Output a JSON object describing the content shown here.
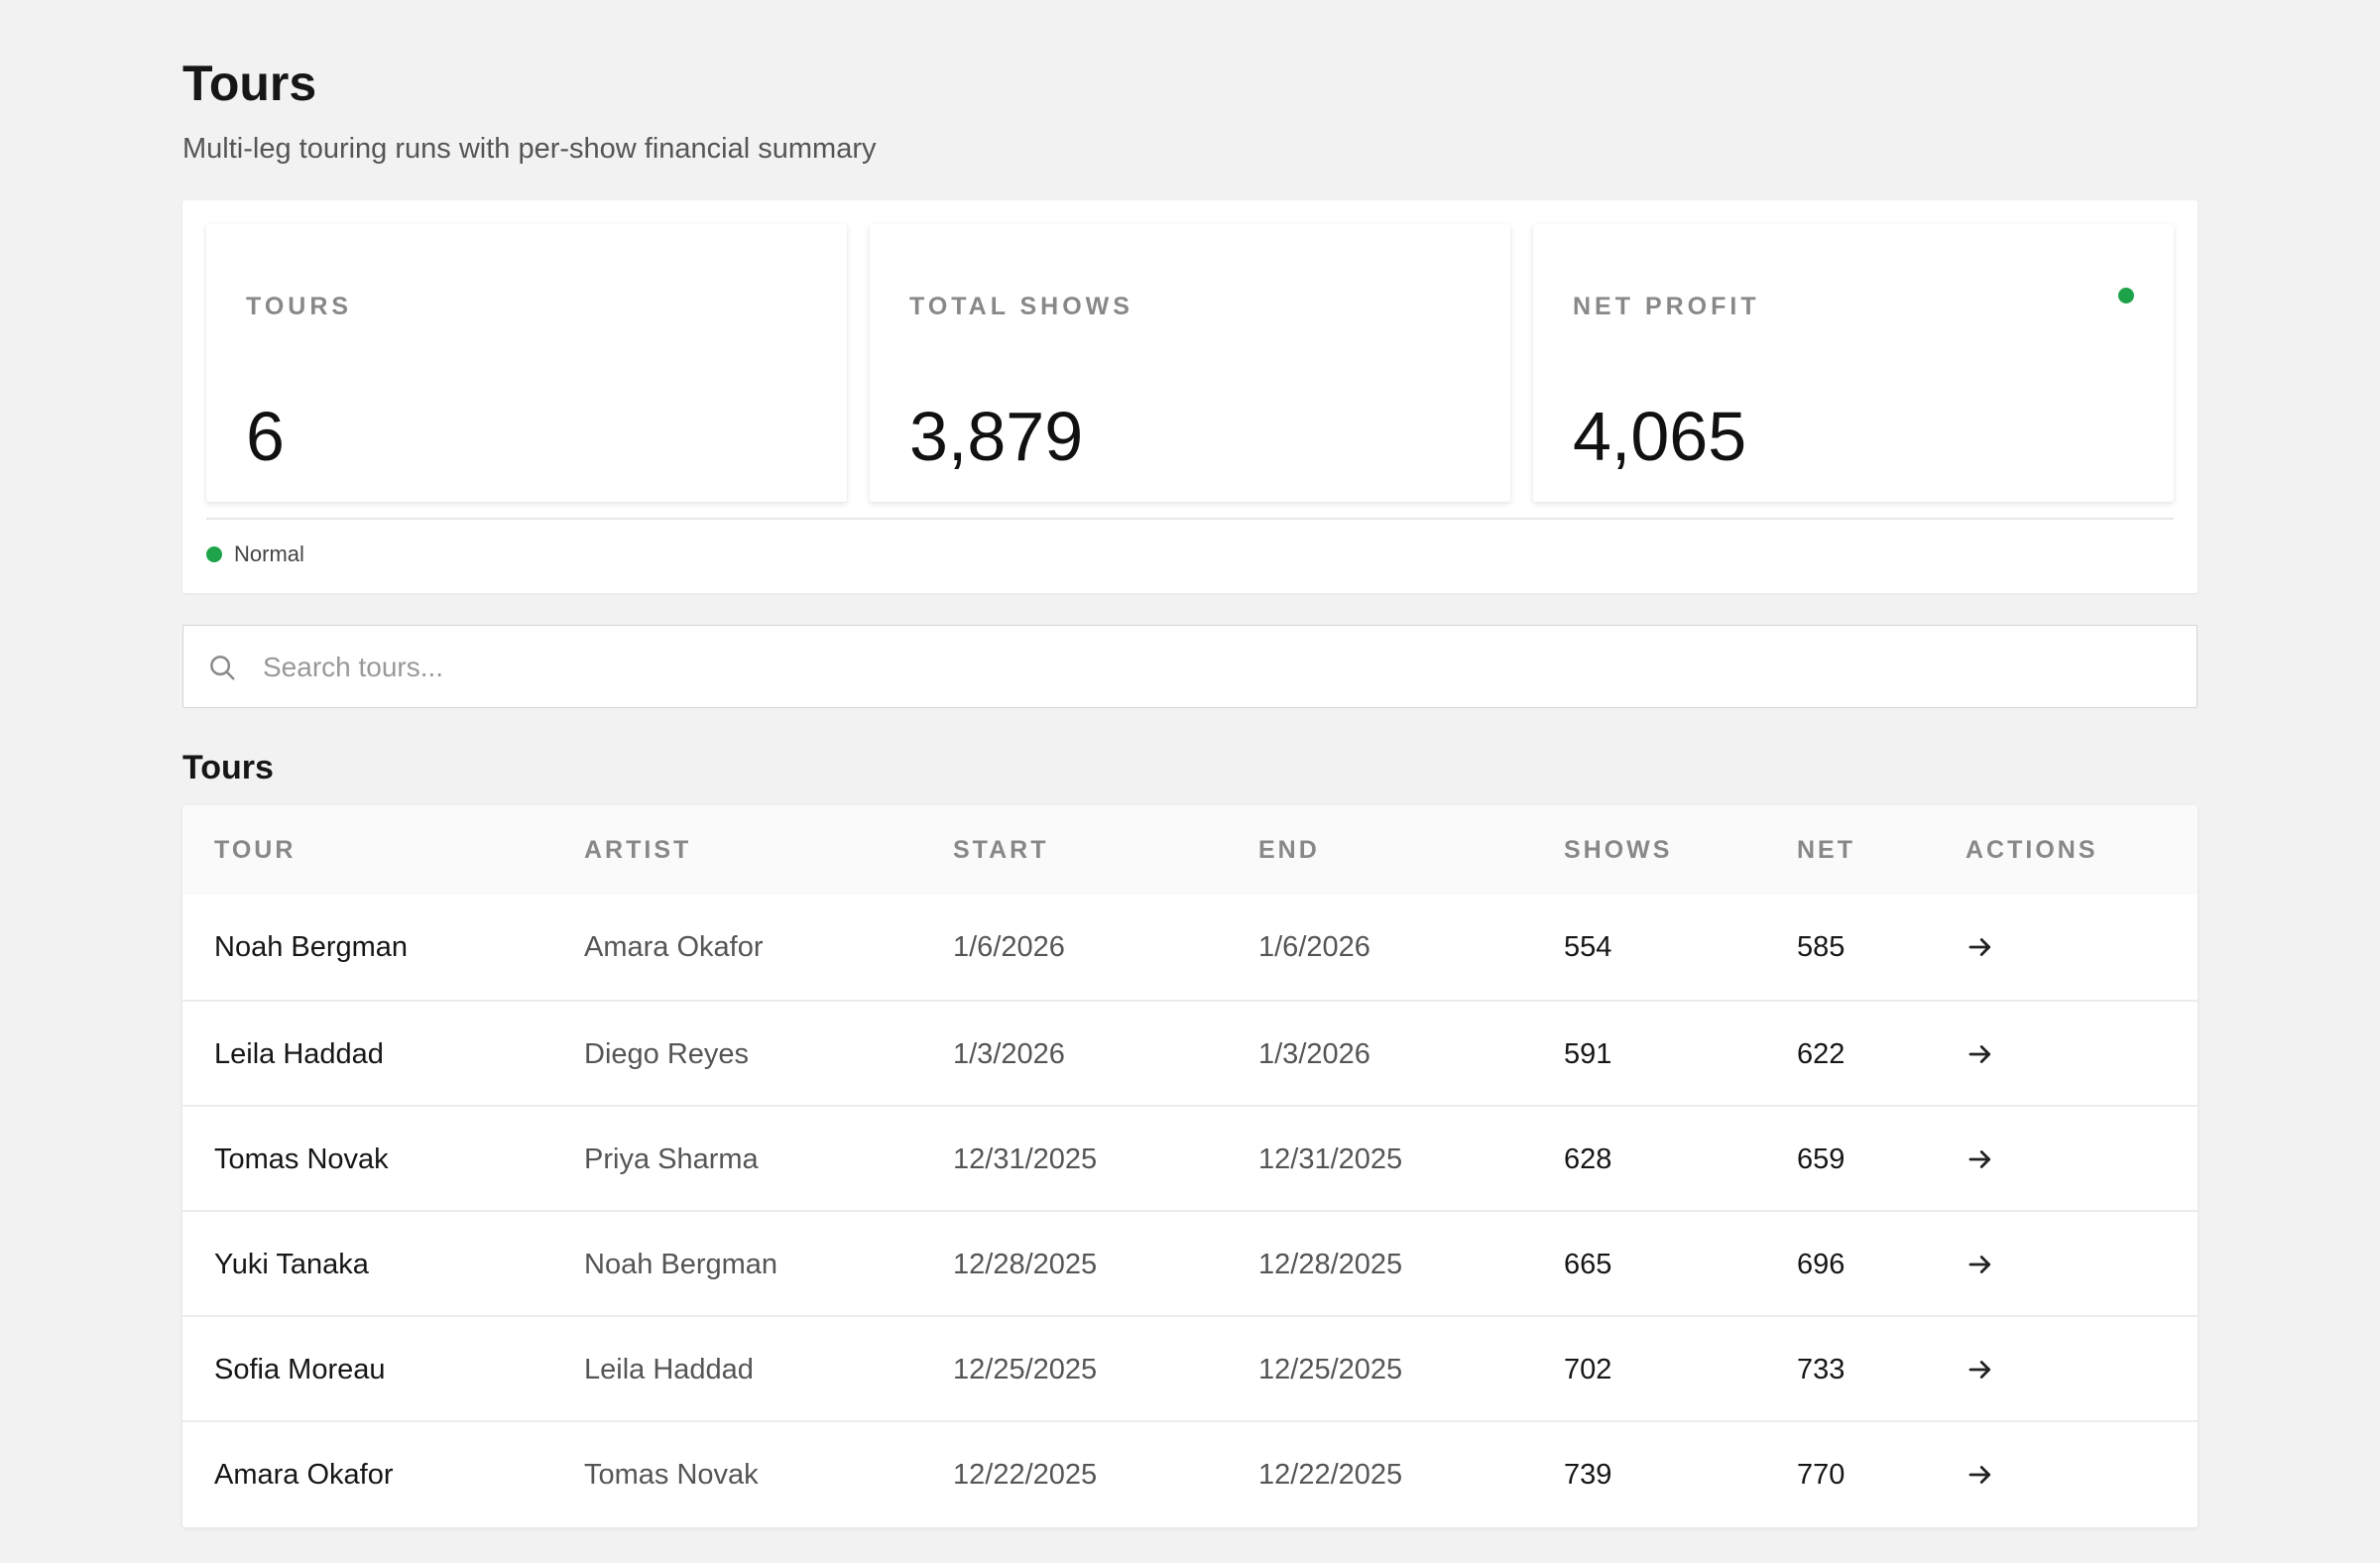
{
  "header": {
    "title": "Tours",
    "subtitle": "Multi-leg touring runs with per-show financial summary"
  },
  "stats": [
    {
      "label": "TOURS",
      "value": "6"
    },
    {
      "label": "TOTAL SHOWS",
      "value": "3,879"
    },
    {
      "label": "NET PROFIT",
      "value": "4,065",
      "indicator_color": "#1fa34a"
    }
  ],
  "status": {
    "label": "Normal",
    "color": "#1fa34a"
  },
  "search": {
    "placeholder": "Search tours...",
    "value": ""
  },
  "table": {
    "title": "Tours",
    "columns": [
      "TOUR",
      "ARTIST",
      "START",
      "END",
      "SHOWS",
      "NET",
      "ACTIONS"
    ],
    "rows": [
      {
        "tour": "Noah Bergman",
        "artist": "Amara Okafor",
        "start": "1/6/2026",
        "end": "1/6/2026",
        "shows": "554",
        "net": "585",
        "action_icon": "arrow-right-icon"
      },
      {
        "tour": "Leila Haddad",
        "artist": "Diego Reyes",
        "start": "1/3/2026",
        "end": "1/3/2026",
        "shows": "591",
        "net": "622",
        "action_icon": "arrow-right-icon"
      },
      {
        "tour": "Tomas Novak",
        "artist": "Priya Sharma",
        "start": "12/31/2025",
        "end": "12/31/2025",
        "shows": "628",
        "net": "659",
        "action_icon": "arrow-right-icon"
      },
      {
        "tour": "Yuki Tanaka",
        "artist": "Noah Bergman",
        "start": "12/28/2025",
        "end": "12/28/2025",
        "shows": "665",
        "net": "696",
        "action_icon": "arrow-right-icon"
      },
      {
        "tour": "Sofia Moreau",
        "artist": "Leila Haddad",
        "start": "12/25/2025",
        "end": "12/25/2025",
        "shows": "702",
        "net": "733",
        "action_icon": "arrow-right-icon"
      },
      {
        "tour": "Amara Okafor",
        "artist": "Tomas Novak",
        "start": "12/22/2025",
        "end": "12/22/2025",
        "shows": "739",
        "net": "770",
        "action_icon": "arrow-right-icon"
      }
    ]
  }
}
